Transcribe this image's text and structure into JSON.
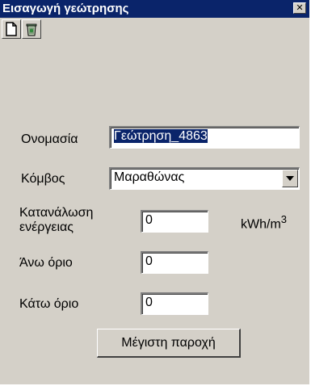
{
  "window": {
    "title": "Εισαγωγή γεώτρησης",
    "close_glyph": "✕"
  },
  "toolbar": {
    "items": [
      {
        "name": "new-document-icon"
      },
      {
        "name": "recycle-bin-icon"
      }
    ]
  },
  "form": {
    "name_label": "Ονομασία",
    "name_value": "Γεώτρηση_4863",
    "node_label": "Κόμβος",
    "node_value": "Μαραθώνας",
    "energy_label_line1": "Κατανάλωση",
    "energy_label_line2": "ενέργειας",
    "energy_value": "0",
    "energy_unit": "kWh/m",
    "energy_unit_exp": "3",
    "upper_label": "Άνω όριο",
    "upper_value": "0",
    "lower_label": "Κάτω όριο",
    "lower_value": "0",
    "max_button": "Μέγιστη παροχή"
  },
  "colors": {
    "titlebar": "#0a246a",
    "face": "#d4d0c8",
    "selection": "#0a246a"
  }
}
